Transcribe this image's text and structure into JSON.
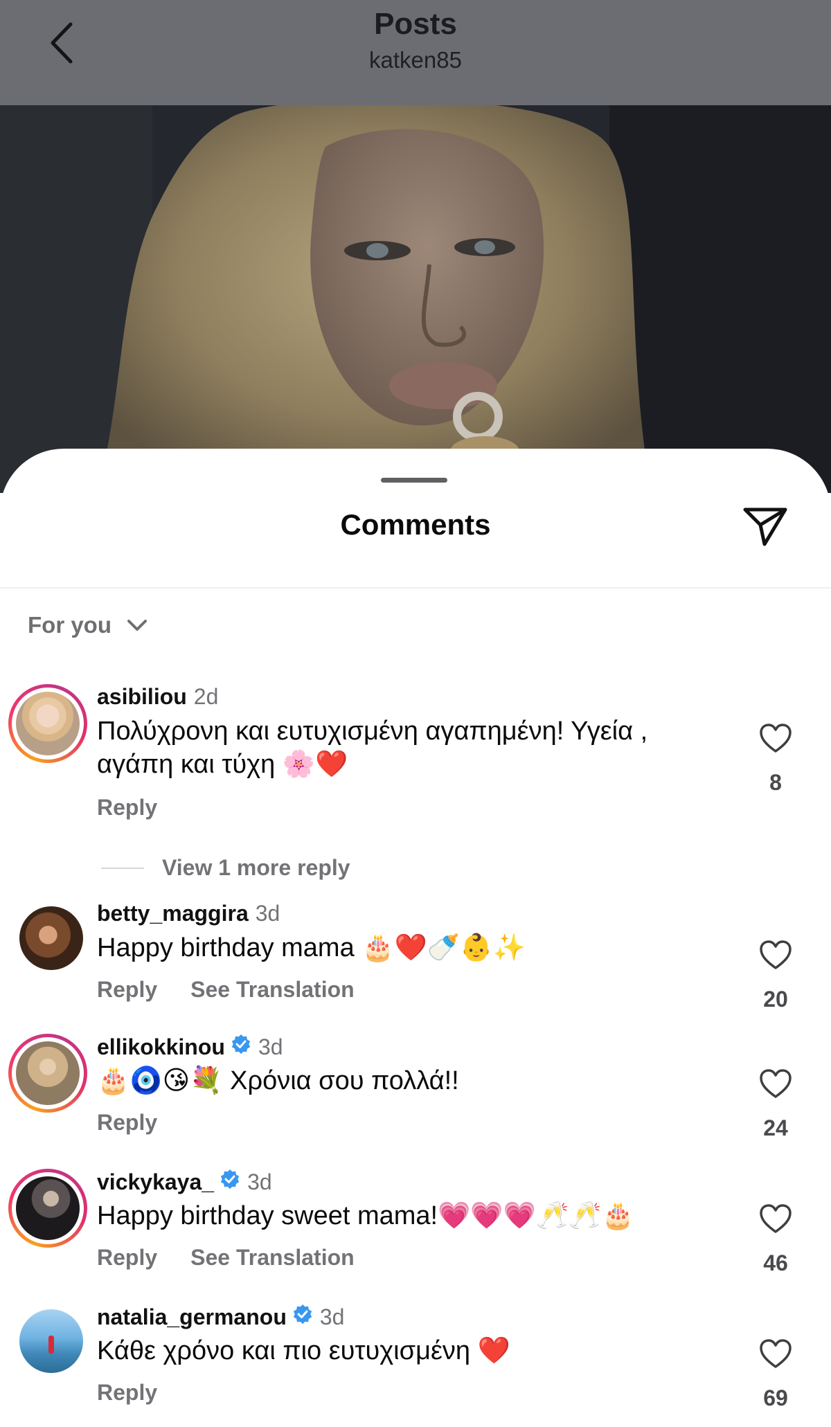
{
  "header": {
    "title": "Posts",
    "username": "katken85"
  },
  "sheet": {
    "title": "Comments",
    "filter_label": "For you"
  },
  "comments": [
    {
      "username": "asibiliou",
      "time": "2d",
      "verified": false,
      "text": "Πολύχρονη και ευτυχισμένη αγαπημένη! Υγεία , αγάπη και τύχη 🌸❤️",
      "reply_label": "Reply",
      "likes": "8",
      "more_replies": "View 1 more reply"
    },
    {
      "username": "betty_maggira",
      "time": "3d",
      "verified": false,
      "text": "Happy birthday mama 🎂❤️🍼👶✨",
      "reply_label": "Reply",
      "translation_label": "See Translation",
      "likes": "20"
    },
    {
      "username": "ellikokkinou",
      "time": "3d",
      "verified": true,
      "text": "🎂🧿😘💐 Χρόνια σου πολλά!!",
      "reply_label": "Reply",
      "likes": "24"
    },
    {
      "username": "vickykaya_",
      "time": "3d",
      "verified": true,
      "text": "Happy birthday sweet mama!💗💗💗🥂🥂🎂",
      "reply_label": "Reply",
      "translation_label": "See Translation",
      "likes": "46"
    },
    {
      "username": "natalia_germanou",
      "time": "3d",
      "verified": true,
      "text": "Κάθε χρόνο και πιο ευτυχισμένη ❤️",
      "reply_label": "Reply",
      "likes": "69"
    }
  ],
  "colors": {
    "header_bg": "#6b6d72",
    "verified_blue": "#3897f0",
    "muted_text": "#737377",
    "story_ring": "#e1306c"
  },
  "icons": [
    "back-chevron-icon",
    "share-paper-plane-icon",
    "chevron-down-icon",
    "heart-outline-icon",
    "verified-badge-icon"
  ]
}
